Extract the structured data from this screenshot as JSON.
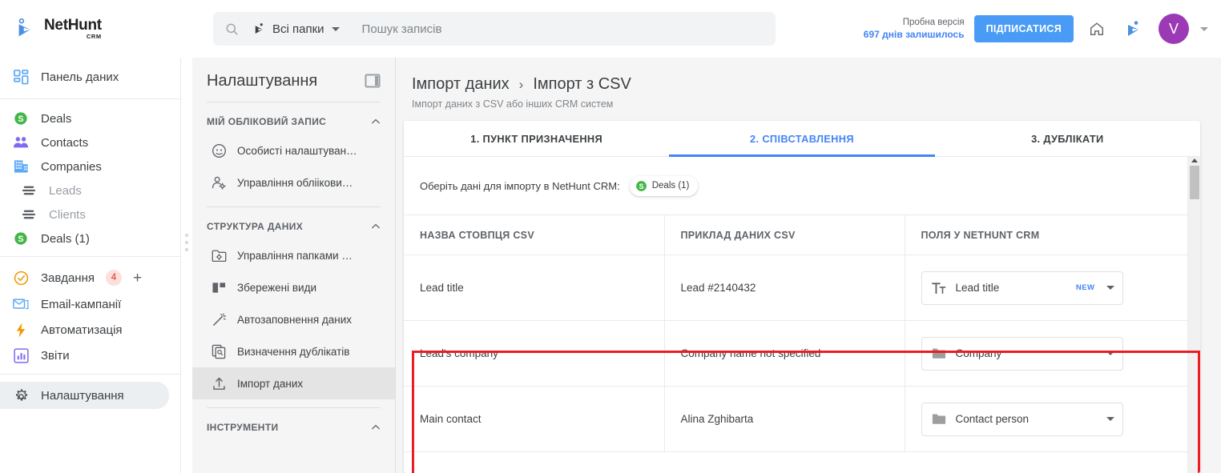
{
  "brand": {
    "name": "NetHunt",
    "sub": "CRM"
  },
  "topbar": {
    "folders_label": "Всі папки",
    "search_placeholder": "Пошук записів",
    "trial_line1": "Пробна версія",
    "trial_line2": "697 днів залишилось",
    "subscribe_label": "ПІДПИСАТИСЯ",
    "avatar_initial": "V",
    "icons": {
      "search": "search-icon",
      "folders": "folder-bird-icon",
      "home": "home-icon",
      "bird": "nethunt-bird-icon"
    }
  },
  "nav": {
    "dashboard": {
      "label": "Панель даних",
      "icon": "dashboard-grid-icon"
    },
    "items": [
      {
        "label": "Deals",
        "icon": "deal-dollar-icon",
        "dim": false,
        "indent": false
      },
      {
        "label": "Contacts",
        "icon": "contacts-people-icon",
        "dim": false,
        "indent": false
      },
      {
        "label": "Companies",
        "icon": "company-building-icon",
        "dim": false,
        "indent": false
      },
      {
        "label": "Leads",
        "icon": "list-lines-icon",
        "dim": true,
        "indent": true
      },
      {
        "label": "Clients",
        "icon": "list-lines-icon",
        "dim": true,
        "indent": true
      },
      {
        "label": "Deals (1)",
        "icon": "deal-dollar-icon",
        "dim": false,
        "indent": false
      }
    ],
    "items2": [
      {
        "label": "Завдання",
        "icon": "task-check-icon",
        "badge": "4",
        "plus": "+"
      },
      {
        "label": "Email-кампанії",
        "icon": "email-envelope-icon"
      },
      {
        "label": "Автоматизація",
        "icon": "automation-bolt-icon"
      },
      {
        "label": "Звіти",
        "icon": "reports-chart-icon"
      }
    ],
    "settings": {
      "label": "Налаштування",
      "icon": "gear-icon"
    }
  },
  "settings_panel": {
    "title": "Налаштування",
    "toggle_icon": "panel-collapse-icon",
    "sections": [
      {
        "label": "МІЙ ОБЛІКОВИЙ ЗАПИС",
        "items": [
          {
            "label": "Особисті налаштуван…",
            "icon": "person-circle-icon",
            "active": false
          },
          {
            "label": "Управління обліікови…",
            "icon": "user-gear-icon",
            "active": false
          }
        ]
      },
      {
        "label": "СТРУКТУРА ДАНИХ",
        "items": [
          {
            "label": "Управління папками …",
            "icon": "folder-gear-icon",
            "active": false
          },
          {
            "label": "Збережені види",
            "icon": "saved-views-icon",
            "active": false
          },
          {
            "label": "Автозаповнення даних",
            "icon": "magic-wand-icon",
            "active": false
          },
          {
            "label": "Визначення дублікатів",
            "icon": "duplicate-search-icon",
            "active": false
          },
          {
            "label": "Імпорт даних",
            "icon": "import-upload-icon",
            "active": true
          }
        ]
      },
      {
        "label": "ІНСТРУМЕНТИ",
        "items": []
      }
    ]
  },
  "main": {
    "breadcrumb": {
      "root": "Імпорт даних",
      "sep": "›",
      "current": "Імпорт з CSV"
    },
    "description": "Імпорт даних з CSV або інших CRM систем",
    "tabs": [
      {
        "label": "1. ПУНКТ ПРИЗНАЧЕННЯ",
        "active": false
      },
      {
        "label": "2. СПІВСТАВЛЕННЯ",
        "active": true
      },
      {
        "label": "3. ДУБЛІКАТИ",
        "active": false
      }
    ],
    "choose": {
      "label": "Оберіть дані для імпорту в NetHunt CRM:",
      "chip_label": "Deals (1)",
      "chip_icon": "deal-dollar-icon"
    },
    "table": {
      "headers": [
        "НАЗВА СТОВПЦЯ CSV",
        "ПРИКЛАД ДАНИХ CSV",
        "ПОЛЯ У NETHUNT CRM"
      ],
      "rows": [
        {
          "csv_column": "Lead title",
          "csv_sample": "Lead #2140432",
          "field": {
            "label": "Lead title",
            "icon": "text-format-icon",
            "badge": "NEW"
          },
          "highlighted": false
        },
        {
          "csv_column": "Lead's company",
          "csv_sample": "Company name not specified",
          "field": {
            "label": "Company",
            "icon": "folder-icon",
            "badge": ""
          },
          "highlighted": true
        },
        {
          "csv_column": "Main contact",
          "csv_sample": "Alina Zghibarta",
          "field": {
            "label": "Contact person",
            "icon": "folder-icon",
            "badge": ""
          },
          "highlighted": true
        }
      ]
    }
  },
  "colors": {
    "accent": "#4285f4",
    "subscribe": "#4a9bf5",
    "avatar": "#9c3ab5",
    "green": "#43b649",
    "purple": "#7e6cf0",
    "blue_light": "#5ba8f7",
    "orange": "#f29900",
    "highlight_red": "#ed1c24",
    "badge_bg": "#fde0dc",
    "badge_fg": "#d93025"
  }
}
